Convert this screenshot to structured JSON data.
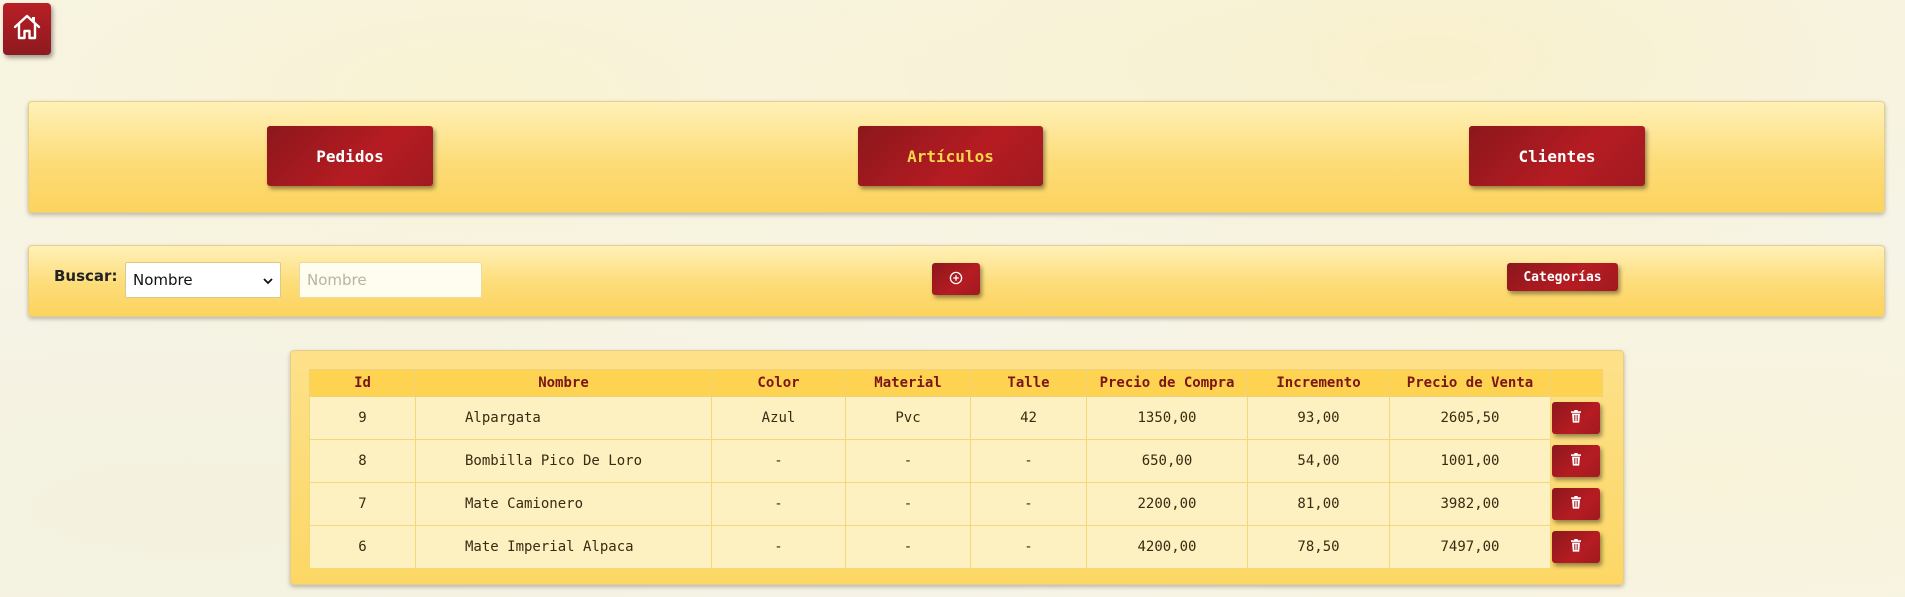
{
  "home": {
    "icon": "home-icon"
  },
  "nav": {
    "items": [
      {
        "label": "Pedidos",
        "active": false
      },
      {
        "label": "Artículos",
        "active": true
      },
      {
        "label": "Clientes",
        "active": false
      }
    ],
    "active_color": "#f6d74c"
  },
  "search": {
    "label": "Buscar:",
    "field_selected": "Nombre",
    "input_placeholder": "Nombre",
    "add_icon": "plus-circle-icon",
    "categories_label": "Categorías"
  },
  "table": {
    "headers": [
      "Id",
      "Nombre",
      "Color",
      "Material",
      "Talle",
      "Precio de Compra",
      "Incremento",
      "Precio de Venta"
    ],
    "rows": [
      {
        "id": "9",
        "nombre": "Alpargata",
        "color": "Azul",
        "material": "Pvc",
        "talle": "42",
        "precio_compra": "1350,00",
        "incremento": "93,00",
        "precio_venta": "2605,50"
      },
      {
        "id": "8",
        "nombre": "Bombilla Pico De Loro",
        "color": "-",
        "material": "-",
        "talle": "-",
        "precio_compra": "650,00",
        "incremento": "54,00",
        "precio_venta": "1001,00"
      },
      {
        "id": "7",
        "nombre": "Mate Camionero",
        "color": "-",
        "material": "-",
        "talle": "-",
        "precio_compra": "2200,00",
        "incremento": "81,00",
        "precio_venta": "3982,00"
      },
      {
        "id": "6",
        "nombre": "Mate Imperial Alpaca",
        "color": "-",
        "material": "-",
        "talle": "-",
        "precio_compra": "4200,00",
        "incremento": "78,50",
        "precio_venta": "7497,00"
      }
    ],
    "delete_icon": "trash-icon"
  },
  "colors": {
    "primary_red": "#a01a20",
    "panel_yellow": "#fdd351",
    "row_bg": "#fdf1c2",
    "header_text": "#7a1518"
  }
}
